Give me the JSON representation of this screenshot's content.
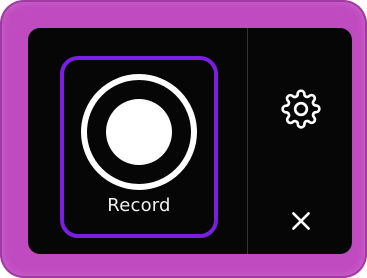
{
  "widget": {
    "record_label": "Record",
    "icons": {
      "record": "record-icon",
      "settings": "gear-icon",
      "close": "close-icon"
    },
    "colors": {
      "frame": "#c04bc0",
      "panel": "#060606",
      "record_tile_border": "#7a1fe2",
      "icon": "#ffffff"
    }
  }
}
